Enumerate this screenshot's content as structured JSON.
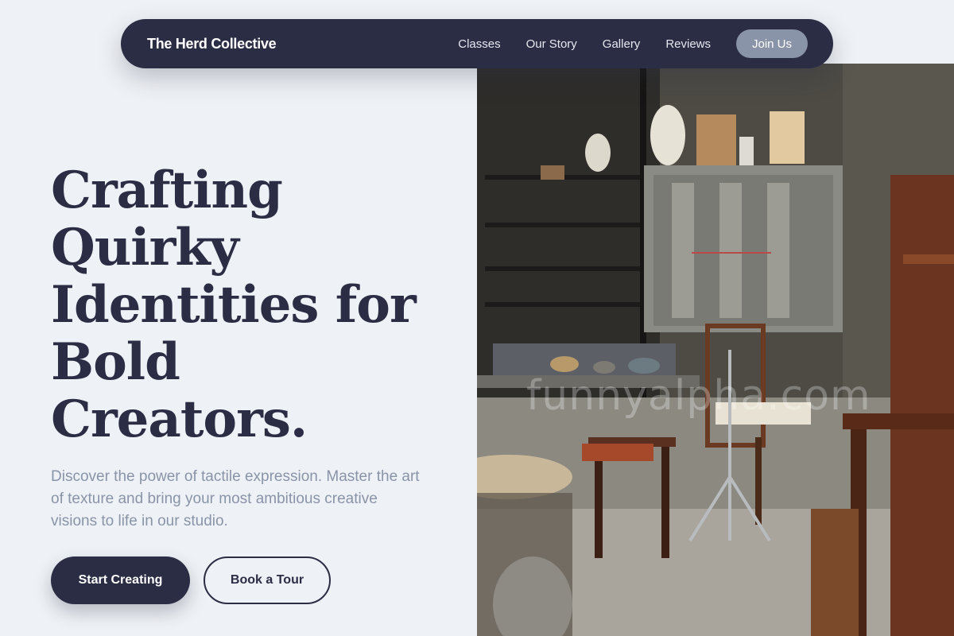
{
  "nav": {
    "brand": "The Herd Collective",
    "links": [
      "Classes",
      "Our Story",
      "Gallery",
      "Reviews"
    ],
    "cta": "Join Us"
  },
  "hero": {
    "headline_lines": [
      "Crafting",
      "Quirky",
      "Identities for",
      "Bold",
      "Creators."
    ],
    "subtext": "Discover the power of tactile expression. Master the art of texture and bring your most ambitious creative visions to life in our studio.",
    "primary_button": "Start Creating",
    "secondary_button": "Book a Tour"
  },
  "image": {
    "description_icon": "pottery-studio-photo",
    "watermark": "funnyalpha.com"
  },
  "colors": {
    "background": "#eef1f5",
    "navy": "#2b2d45",
    "muted": "#8a94a8"
  }
}
